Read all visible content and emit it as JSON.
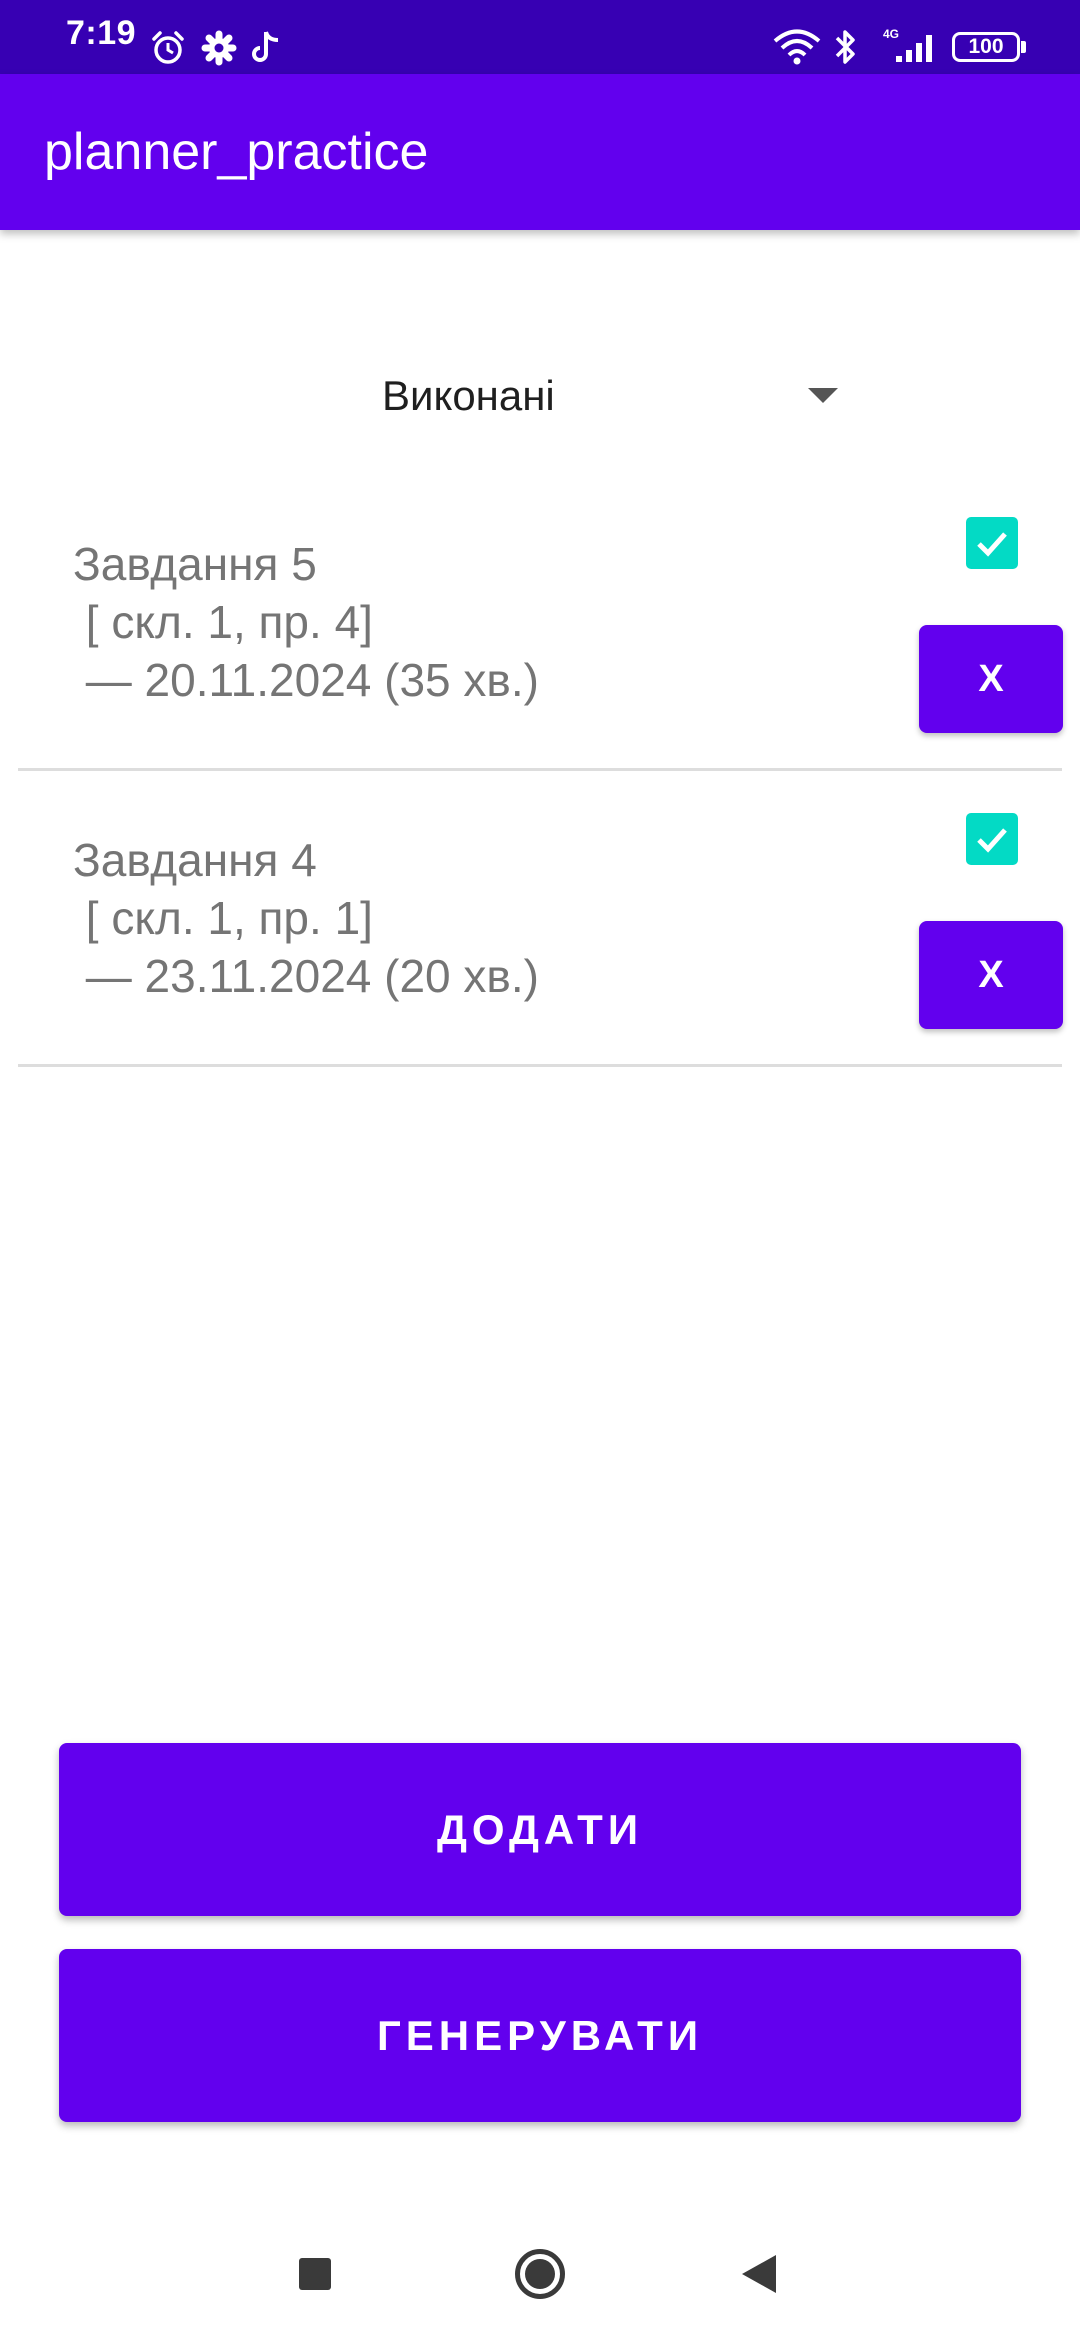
{
  "status_bar": {
    "time": "7:19",
    "battery": "100",
    "network": "4G",
    "icons": [
      "alarm-icon",
      "gear-icon",
      "tiktok-icon",
      "wifi-icon",
      "bluetooth-icon",
      "signal-icon",
      "battery-icon"
    ]
  },
  "app_bar": {
    "title": "planner_practice"
  },
  "filter": {
    "selected": "Виконані"
  },
  "tasks": [
    {
      "title": "Завдання 5",
      "details": " [ скл. 1, пр. 4]",
      "date": " — 20.11.2024 (35 хв.)",
      "done": true,
      "delete_label": "X"
    },
    {
      "title": "Завдання 4",
      "details": " [ скл. 1, пр. 1]",
      "date": " — 23.11.2024 (20 хв.)",
      "done": true,
      "delete_label": "X"
    }
  ],
  "actions": {
    "add_label": "ДОДАТИ",
    "generate_label": "ГЕНЕРУВАТИ"
  },
  "colors": {
    "status_bar": "#3700b3",
    "primary": "#6200ee",
    "checkbox": "#03dac5",
    "task_text": "#757575",
    "divider": "#dddddd"
  }
}
